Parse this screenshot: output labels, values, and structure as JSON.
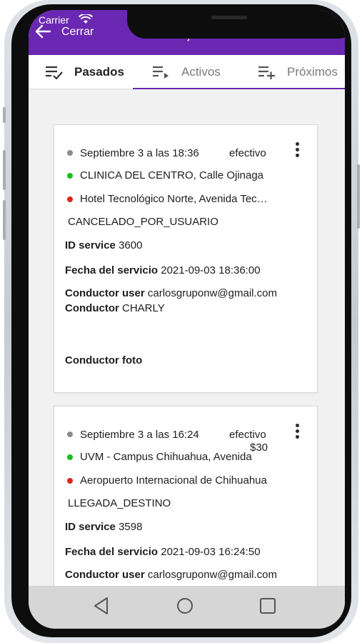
{
  "status_bar": {
    "carrier": "Carrier"
  },
  "header": {
    "close_label": "Cerrar",
    "title": "Viajes"
  },
  "tabs": [
    {
      "label": "Pasados",
      "icon": "list-check-icon",
      "active": true
    },
    {
      "label": "Activos",
      "icon": "list-arrow-icon",
      "active": false
    },
    {
      "label": "Próximos",
      "icon": "playlist-add-icon",
      "active": false
    }
  ],
  "colors": {
    "accent": "#6a28b2",
    "origin_dot": "#15c21b",
    "destination_dot": "#e0241b"
  },
  "trips": [
    {
      "date": "Septiembre 3 a las 18:36",
      "payment": "efectivo",
      "price": "",
      "origin": "CLINICA DEL CENTRO, Calle Ojinaga",
      "destination": "Hotel Tecnológico Norte, Avenida Tecnológico",
      "status": "CANCELADO_POR_USUARIO",
      "id_label": "ID service",
      "id_value": "3600",
      "fecha_label": "Fecha del servicio",
      "fecha_value": "2021-09-03 18:36:00",
      "conductor_user_label": "Conductor user",
      "conductor_user_value": "carlosgruponw@gmail.com",
      "conductor_label": "Conductor",
      "conductor_value": "CHARLY",
      "foto_label": "Conductor foto"
    },
    {
      "date": "Septiembre 3 a las 16:24",
      "payment": "efectivo",
      "price": "$30",
      "origin": "UVM - Campus Chihuahua, Avenida",
      "destination": "Aeropuerto Internacional de Chihuahua",
      "status": "LLEGADA_DESTINO",
      "id_label": "ID service",
      "id_value": "3598",
      "fecha_label": "Fecha del servicio",
      "fecha_value": "2021-09-03 16:24:50",
      "conductor_user_label": "Conductor user",
      "conductor_user_value": "carlosgruponw@gmail.com"
    }
  ],
  "system_nav": [
    {
      "icon": "back-triangle-icon"
    },
    {
      "icon": "home-circle-icon"
    },
    {
      "icon": "recents-square-icon"
    }
  ]
}
